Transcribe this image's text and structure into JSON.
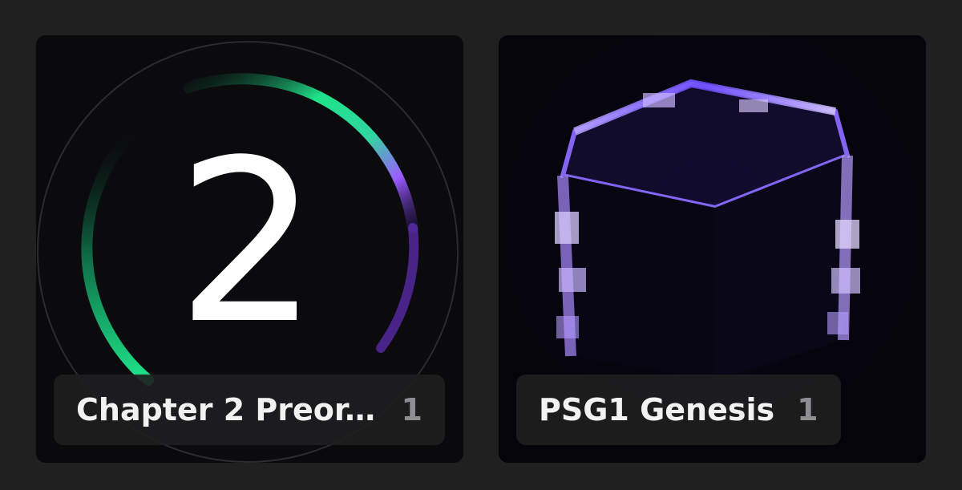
{
  "collections": [
    {
      "title": "Chapter 2 Preor...",
      "count": "1",
      "image": "chapter-2-ring-art",
      "ring_colors": [
        "#1fe38a",
        "#15b97a",
        "#9b5cff",
        "#7c3aed"
      ]
    },
    {
      "title": "PSG1 Genesis",
      "count": "1",
      "image": "glowing-crystal-cube-art",
      "glow_color": "#6b4bff"
    }
  ]
}
